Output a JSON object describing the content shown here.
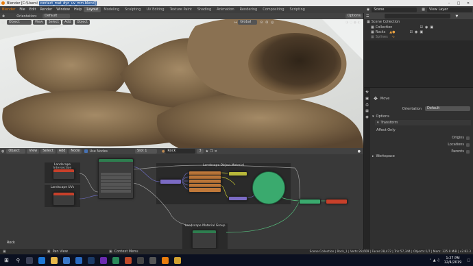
{
  "window": {
    "title": "Blender [C:\\Users\\",
    "title_file": "contact_mat_dyn_uv_mm.blend]"
  },
  "menu": [
    "Blender",
    "File",
    "Edit",
    "Render",
    "Window",
    "Help"
  ],
  "workspaces": [
    "Layout",
    "Modeling",
    "Sculpting",
    "UV Editing",
    "Texture Paint",
    "Shading",
    "Animation",
    "Rendering",
    "Compositing",
    "Scripting"
  ],
  "scene": {
    "label": "Scene",
    "view_layer": "View Layer"
  },
  "tool_header": {
    "orientation_label": "Orientation:",
    "orientation_value": "Default",
    "options": "Options"
  },
  "viewport_header": {
    "mode": "Object Mode",
    "items": [
      "View",
      "Select",
      "Add",
      "Object"
    ],
    "transform": "Global"
  },
  "outliner": {
    "title": "Scene Collection",
    "items": [
      {
        "label": "Collection"
      },
      {
        "label": "Rocks"
      },
      {
        "label": "Splines"
      }
    ]
  },
  "properties": {
    "move_label": "Move",
    "orientation_label": "Orientation",
    "orientation_value": "Default",
    "options_section": "Options",
    "transform_section": "Transform",
    "affect_only": "Affect Only",
    "origins": "Origins",
    "locations": "Locations",
    "parents": "Parents",
    "workspace_section": "Workspace"
  },
  "node_header": {
    "editor": "Object",
    "items": [
      "View",
      "Select",
      "Add",
      "Node"
    ],
    "use_nodes": "Use Nodes",
    "slot": "Slot 1",
    "material": "Rock",
    "users": "3"
  },
  "frames": {
    "landscape_intersection": "Landscape Intersection",
    "landscape_uvs": "Landscape UVs",
    "landscape_object_material": "Landscape Object Material",
    "landscape_material_group": "Landscape Material Group"
  },
  "node_editor_label": "Rock",
  "statusbar": {
    "pan_view": "Pan View",
    "context_menu": "Context Menu",
    "stats": "Scene Collection | Rock_1 | Verts:28,609 | Faces:28,472 | Tris:57,344 | Objects:1/7 | Mem: 325.9 MiB | v2.82.3"
  },
  "taskbar": {
    "time": "1:27 PM",
    "date": "12/4/2019"
  }
}
